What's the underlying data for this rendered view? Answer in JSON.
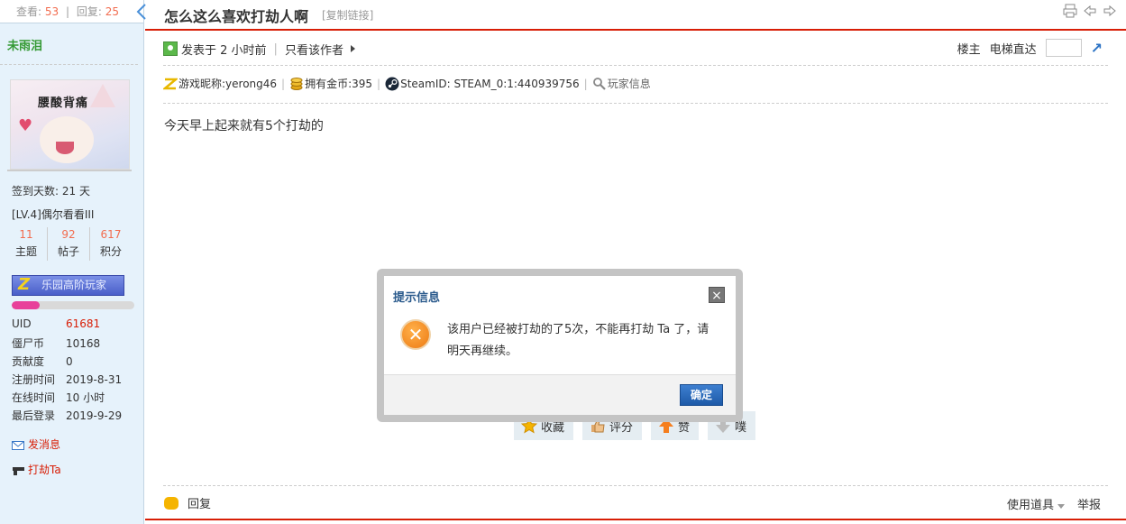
{
  "stats": {
    "views_label": "查看:",
    "views": "53",
    "replies_label": "回复:",
    "replies": "25"
  },
  "author": {
    "name": "未雨泪",
    "avatar_caption": "腰酸背痛"
  },
  "profile": {
    "checkin": "签到天数: 21 天",
    "level": "[LV.4]偶尔看看III",
    "counts": [
      {
        "value": "11",
        "label": "主题"
      },
      {
        "value": "92",
        "label": "帖子"
      },
      {
        "value": "617",
        "label": "积分"
      }
    ],
    "medal_label": "乐园高阶玩家",
    "progress_fraction": 0.23,
    "fields": [
      {
        "key": "UID",
        "value": "61681"
      },
      {
        "key": "僵尸币",
        "value": "10168"
      },
      {
        "key": "贡献度",
        "value": "0"
      },
      {
        "key": "注册时间",
        "value": "2019-8-31"
      },
      {
        "key": "在线时间",
        "value": "10 小时"
      },
      {
        "key": "最后登录",
        "value": "2019-9-29"
      }
    ],
    "send_message": "发消息",
    "rob": "打劫Ta"
  },
  "thread": {
    "title": "怎么这么喜欢打劫人啊",
    "copy_link": "[复制链接]"
  },
  "post": {
    "posted": "发表于 2 小时前",
    "only_author": "只看该作者",
    "floor_owner": "楼主",
    "elevator": "电梯直达",
    "game_nick": "游戏昵称:yerong46",
    "gold": "拥有金币:395",
    "steam": "SteamID: STEAM_0:1:440939756",
    "player_info": "玩家信息",
    "content": "今天早上起来就有5个打劫的"
  },
  "actions": {
    "fav": "收藏",
    "rate": "评分",
    "like": "赞",
    "dislike": "噗"
  },
  "footer": {
    "reply": "回复",
    "tools": "使用道具",
    "report": "举报"
  },
  "dialog": {
    "title": "提示信息",
    "message": "该用户已经被打劫的了5次，不能再打劫 Ta 了，请明天再继续。",
    "ok": "确定"
  },
  "colors": {
    "accent_red": "#d81e06",
    "sidebar_bg": "#e6f2fb",
    "author_green": "#339933"
  }
}
